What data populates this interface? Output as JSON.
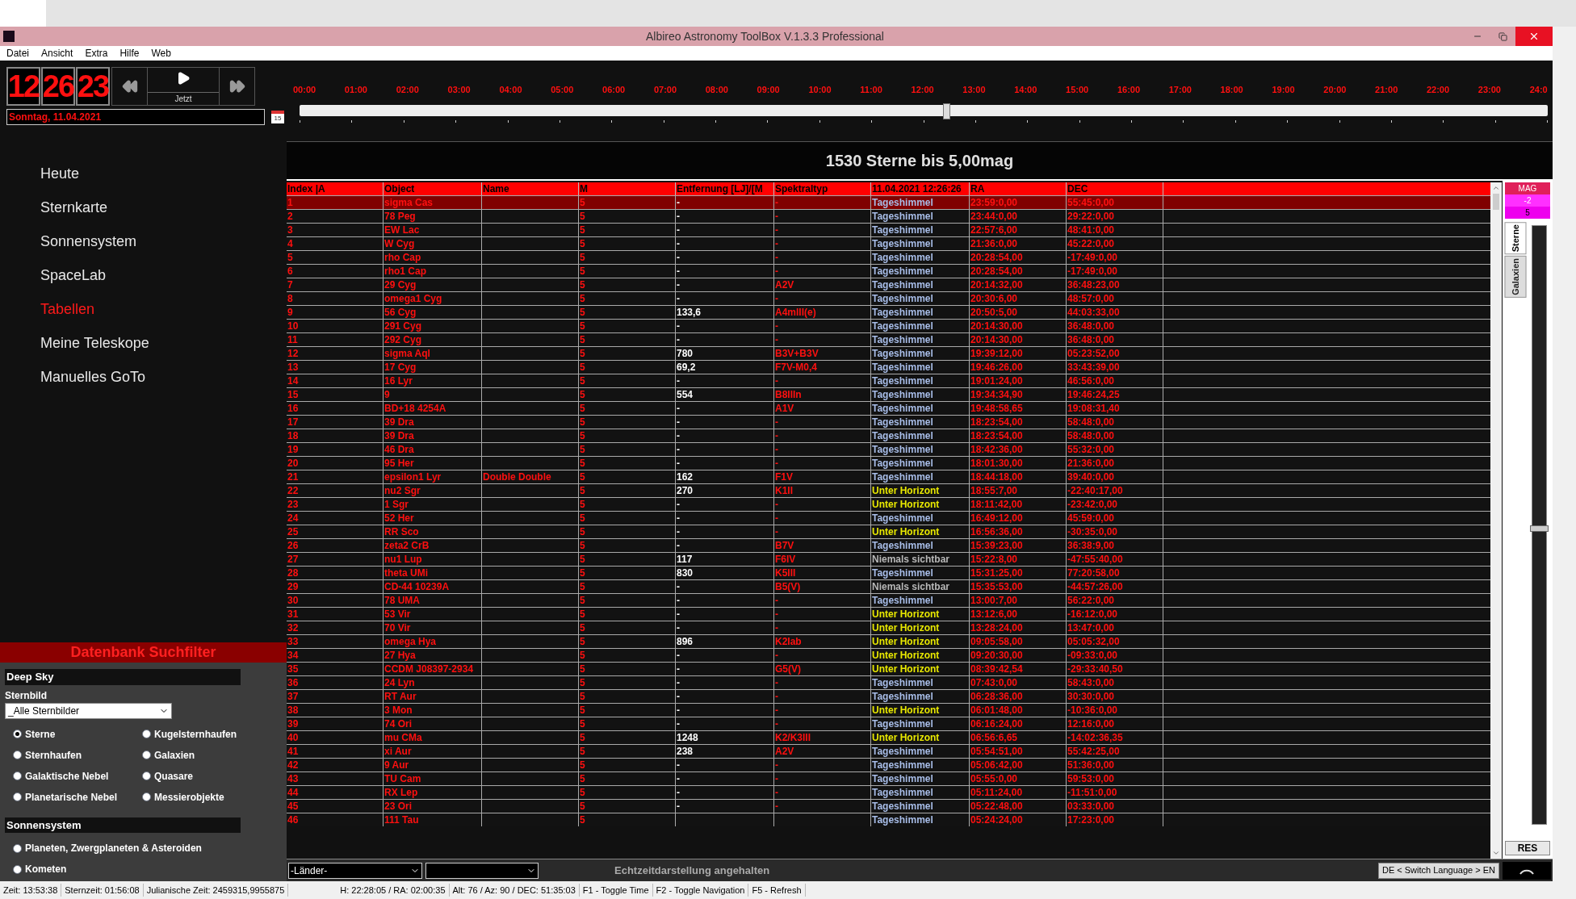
{
  "window": {
    "title": "Albireo Astronomy ToolBox V.1.3.3 Professional"
  },
  "menu": [
    "Datei",
    "Ansicht",
    "Extra",
    "Hilfe",
    "Web"
  ],
  "clock": {
    "hours": "12",
    "minutes": "26",
    "seconds": "23",
    "now_label": "Jetzt",
    "date": "Sonntag, 11.04.2021",
    "calendar_day": "15"
  },
  "timeline": {
    "hours": [
      "00:00",
      "01:00",
      "02:00",
      "03:00",
      "04:00",
      "05:00",
      "06:00",
      "07:00",
      "08:00",
      "09:00",
      "10:00",
      "11:00",
      "12:00",
      "13:00",
      "14:00",
      "15:00",
      "16:00",
      "17:00",
      "18:00",
      "19:00",
      "20:00",
      "21:00",
      "22:00",
      "23:00",
      "24:0"
    ],
    "level": 0.518
  },
  "nav": [
    {
      "label": "Heute",
      "selected": false
    },
    {
      "label": "Sternkarte",
      "selected": false
    },
    {
      "label": "Sonnensystem",
      "selected": false
    },
    {
      "label": "SpaceLab",
      "selected": false
    },
    {
      "label": "Tabellen",
      "selected": true
    },
    {
      "label": "Meine Teleskope",
      "selected": false
    },
    {
      "label": "Manuelles GoTo",
      "selected": false
    }
  ],
  "filter": {
    "title": "Datenbank Suchfilter",
    "deep_sky": {
      "title": "Deep Sky",
      "constellation_label": "Sternbild",
      "constellation_value": "_Alle Sternbilder",
      "options": [
        {
          "label": "Sterne",
          "selected": true
        },
        {
          "label": "Kugelsternhaufen",
          "selected": false
        },
        {
          "label": "Sternhaufen",
          "selected": false
        },
        {
          "label": "Galaxien",
          "selected": false
        },
        {
          "label": "Galaktische Nebel",
          "selected": false
        },
        {
          "label": "Quasare",
          "selected": false
        },
        {
          "label": "Planetarische Nebel",
          "selected": false
        },
        {
          "label": "Messierobjekte",
          "selected": false
        }
      ]
    },
    "solar_system": {
      "title": "Sonnensystem",
      "options": [
        {
          "label": "Planeten, Zwergplaneten & Asteroiden",
          "selected": false
        },
        {
          "label": "Kometen",
          "selected": false
        }
      ]
    }
  },
  "table": {
    "title": "1530 Sterne bis 5,00mag",
    "columns": [
      "Index |A",
      "Object",
      "Name",
      "M",
      "Entfernung [LJ]/[M",
      "Spektraltyp",
      "11.04.2021 12:26:26",
      "RA",
      "DEC"
    ],
    "rows": [
      {
        "cells": [
          "1",
          "sigma Cas",
          null,
          "5",
          "-",
          "-",
          "Tageshimmel",
          "23:59:0,00",
          "55:45:0,00"
        ],
        "kind": "day",
        "selected": true
      },
      {
        "cells": [
          "2",
          "78 Peg",
          null,
          "5",
          "-",
          "-",
          "Tageshimmel",
          "23:44:0,00",
          "29:22:0,00"
        ],
        "kind": "day",
        "selected": false
      },
      {
        "cells": [
          "3",
          "EW Lac",
          null,
          "5",
          "-",
          "-",
          "Tageshimmel",
          "22:57:6,00",
          "48:41:0,00"
        ],
        "kind": "day",
        "selected": false
      },
      {
        "cells": [
          "4",
          "W Cyg",
          null,
          "5",
          "-",
          "-",
          "Tageshimmel",
          "21:36:0,00",
          "45:22:0,00"
        ],
        "kind": "day",
        "selected": false
      },
      {
        "cells": [
          "5",
          "rho Cap",
          null,
          "5",
          "-",
          "-",
          "Tageshimmel",
          "20:28:54,00",
          "-17:49:0,00"
        ],
        "kind": "day",
        "selected": false
      },
      {
        "cells": [
          "6",
          "rho1 Cap",
          null,
          "5",
          "-",
          "-",
          "Tageshimmel",
          "20:28:54,00",
          "-17:49:0,00"
        ],
        "kind": "day",
        "selected": false
      },
      {
        "cells": [
          "7",
          "29 Cyg",
          null,
          "5",
          "-",
          "A2V",
          "Tageshimmel",
          "20:14:32,00",
          "36:48:23,00"
        ],
        "kind": "day",
        "selected": false
      },
      {
        "cells": [
          "8",
          "omega1 Cyg",
          null,
          "5",
          "-",
          "-",
          "Tageshimmel",
          "20:30:6,00",
          "48:57:0,00"
        ],
        "kind": "day",
        "selected": false
      },
      {
        "cells": [
          "9",
          "56 Cyg",
          null,
          "5",
          "133,6",
          "A4mIII(e)",
          "Tageshimmel",
          "20:50:5,00",
          "44:03:33,00"
        ],
        "kind": "day",
        "selected": false
      },
      {
        "cells": [
          "10",
          "291 Cyg",
          null,
          "5",
          "-",
          "-",
          "Tageshimmel",
          "20:14:30,00",
          "36:48:0,00"
        ],
        "kind": "day",
        "selected": false
      },
      {
        "cells": [
          "11",
          "292 Cyg",
          null,
          "5",
          "-",
          "-",
          "Tageshimmel",
          "20:14:30,00",
          "36:48:0,00"
        ],
        "kind": "day",
        "selected": false
      },
      {
        "cells": [
          "12",
          "sigma Aql",
          null,
          "5",
          "780",
          "B3V+B3V",
          "Tageshimmel",
          "19:39:12,00",
          "05:23:52,00"
        ],
        "kind": "day",
        "selected": false
      },
      {
        "cells": [
          "13",
          "17 Cyg",
          null,
          "5",
          "69,2",
          "F7V-M0,4",
          "Tageshimmel",
          "19:46:26,00",
          "33:43:39,00"
        ],
        "kind": "day",
        "selected": false
      },
      {
        "cells": [
          "14",
          "16 Lyr",
          null,
          "5",
          "-",
          "-",
          "Tageshimmel",
          "19:01:24,00",
          "46:56:0,00"
        ],
        "kind": "day",
        "selected": false
      },
      {
        "cells": [
          "15",
          "9",
          null,
          "5",
          "554",
          "B8IIIn",
          "Tageshimmel",
          "19:34:34,90",
          "19:46:24,25"
        ],
        "kind": "day",
        "selected": false
      },
      {
        "cells": [
          "16",
          "BD+18 4254A",
          null,
          "5",
          "-",
          "A1V",
          "Tageshimmel",
          "19:48:58,65",
          "19:08:31,40"
        ],
        "kind": "day",
        "selected": false
      },
      {
        "cells": [
          "17",
          "39 Dra",
          null,
          "5",
          "-",
          "-",
          "Tageshimmel",
          "18:23:54,00",
          "58:48:0,00"
        ],
        "kind": "day",
        "selected": false
      },
      {
        "cells": [
          "18",
          "39 Dra",
          null,
          "5",
          "-",
          "-",
          "Tageshimmel",
          "18:23:54,00",
          "58:48:0,00"
        ],
        "kind": "day",
        "selected": false
      },
      {
        "cells": [
          "19",
          "46 Dra",
          null,
          "5",
          "-",
          "-",
          "Tageshimmel",
          "18:42:36,00",
          "55:32:0,00"
        ],
        "kind": "day",
        "selected": false
      },
      {
        "cells": [
          "20",
          "95 Her",
          null,
          "5",
          "-",
          "-",
          "Tageshimmel",
          "18:01:30,00",
          "21:36:0,00"
        ],
        "kind": "day",
        "selected": false
      },
      {
        "cells": [
          "21",
          "epsilon1 Lyr",
          "Double Double",
          "5",
          "162",
          "F1V",
          "Tageshimmel",
          "18:44:18,00",
          "39:40:0,00"
        ],
        "kind": "day",
        "selected": false
      },
      {
        "cells": [
          "22",
          "nu2 Sgr",
          null,
          "5",
          "270",
          "K1II",
          "Unter Horizont",
          "18:55:7,00",
          "-22:40:17,00"
        ],
        "kind": "below",
        "selected": false
      },
      {
        "cells": [
          "23",
          "1 Sgr",
          null,
          "5",
          "-",
          "-",
          "Unter Horizont",
          "18:11:42,00",
          "-23:42:0,00"
        ],
        "kind": "below",
        "selected": false
      },
      {
        "cells": [
          "24",
          "52 Her",
          null,
          "5",
          "-",
          "-",
          "Tageshimmel",
          "16:49:12,00",
          "45:59:0,00"
        ],
        "kind": "day",
        "selected": false
      },
      {
        "cells": [
          "25",
          "RR Sco",
          null,
          "5",
          "-",
          "-",
          "Unter Horizont",
          "16:56:36,00",
          "-30:35:0,00"
        ],
        "kind": "below",
        "selected": false
      },
      {
        "cells": [
          "26",
          "zeta2 CrB",
          null,
          "5",
          "-",
          "B7V",
          "Tageshimmel",
          "15:39:23,00",
          "36:38:9,00"
        ],
        "kind": "day",
        "selected": false
      },
      {
        "cells": [
          "27",
          "nu1 Lup",
          null,
          "5",
          "117",
          "F6IV",
          "Niemals sichtbar",
          "15:22:8,00",
          "-47:55:40,00"
        ],
        "kind": "never",
        "selected": false
      },
      {
        "cells": [
          "28",
          "theta UMi",
          null,
          "5",
          "830",
          "K5III",
          "Tageshimmel",
          "15:31:25,00",
          "77:20:58,00"
        ],
        "kind": "day",
        "selected": false
      },
      {
        "cells": [
          "29",
          "CD-44 10239A",
          null,
          "5",
          "-",
          "B5(V)",
          "Niemals sichtbar",
          "15:35:53,00",
          "-44:57:26,00"
        ],
        "kind": "never",
        "selected": false
      },
      {
        "cells": [
          "30",
          "78 UMA",
          null,
          "5",
          "-",
          "-",
          "Tageshimmel",
          "13:00:7,00",
          "56:22:0,00"
        ],
        "kind": "day",
        "selected": false
      },
      {
        "cells": [
          "31",
          "53 Vir",
          null,
          "5",
          "-",
          "-",
          "Unter Horizont",
          "13:12:6,00",
          "-16:12:0,00"
        ],
        "kind": "below",
        "selected": false
      },
      {
        "cells": [
          "32",
          "70 Vir",
          null,
          "5",
          "-",
          "-",
          "Unter Horizont",
          "13:28:24,00",
          "13:47:0,00"
        ],
        "kind": "below",
        "selected": false
      },
      {
        "cells": [
          "33",
          "omega Hya",
          null,
          "5",
          "896",
          "K2Iab",
          "Unter Horizont",
          "09:05:58,00",
          "05:05:32,00"
        ],
        "kind": "below",
        "selected": false
      },
      {
        "cells": [
          "34",
          "27 Hya",
          null,
          "5",
          "-",
          "-",
          "Unter Horizont",
          "09:20:30,00",
          "-09:33:0,00"
        ],
        "kind": "below",
        "selected": false
      },
      {
        "cells": [
          "35",
          "CCDM J08397-2934",
          null,
          "5",
          "-",
          "G5(V)",
          "Unter Horizont",
          "08:39:42,54",
          "-29:33:40,50"
        ],
        "kind": "below",
        "selected": false
      },
      {
        "cells": [
          "36",
          "24 Lyn",
          null,
          "5",
          "-",
          "-",
          "Tageshimmel",
          "07:43:0,00",
          "58:43:0,00"
        ],
        "kind": "day",
        "selected": false
      },
      {
        "cells": [
          "37",
          "RT Aur",
          null,
          "5",
          "-",
          "-",
          "Tageshimmel",
          "06:28:36,00",
          "30:30:0,00"
        ],
        "kind": "day",
        "selected": false
      },
      {
        "cells": [
          "38",
          "3 Mon",
          null,
          "5",
          "-",
          "-",
          "Unter Horizont",
          "06:01:48,00",
          "-10:36:0,00"
        ],
        "kind": "below",
        "selected": false
      },
      {
        "cells": [
          "39",
          "74 Ori",
          null,
          "5",
          "-",
          "-",
          "Tageshimmel",
          "06:16:24,00",
          "12:16:0,00"
        ],
        "kind": "day",
        "selected": false
      },
      {
        "cells": [
          "40",
          "mu CMa",
          null,
          "5",
          "1248",
          "K2/K3III",
          "Unter Horizont",
          "06:56:6,65",
          "-14:02:36,35"
        ],
        "kind": "below",
        "selected": false
      },
      {
        "cells": [
          "41",
          "xi Aur",
          null,
          "5",
          "238",
          "A2V",
          "Tageshimmel",
          "05:54:51,00",
          "55:42:25,00"
        ],
        "kind": "day",
        "selected": false
      },
      {
        "cells": [
          "42",
          "9 Aur",
          null,
          "5",
          "-",
          "-",
          "Tageshimmel",
          "05:06:42,00",
          "51:36:0,00"
        ],
        "kind": "day",
        "selected": false
      },
      {
        "cells": [
          "43",
          "TU Cam",
          null,
          "5",
          "-",
          "-",
          "Tageshimmel",
          "05:55:0,00",
          "59:53:0,00"
        ],
        "kind": "day",
        "selected": false
      },
      {
        "cells": [
          "44",
          "RX Lep",
          null,
          "5",
          "-",
          "-",
          "Tageshimmel",
          "05:11:24,00",
          "-11:51:0,00"
        ],
        "kind": "day",
        "selected": false
      },
      {
        "cells": [
          "45",
          "23 Ori",
          null,
          "5",
          "-",
          "-",
          "Tageshimmel",
          "05:22:48,00",
          "03:33:0,00"
        ],
        "kind": "day",
        "selected": false
      },
      {
        "cells": [
          "46",
          "111 Tau",
          null,
          "5",
          null,
          null,
          "Tageshimmel",
          "05:24:24,00",
          "17:23:0,00"
        ],
        "kind": "day",
        "selected": false
      }
    ]
  },
  "mag_panel": {
    "header": "MAG",
    "min": "-2",
    "max": "5",
    "tabs": [
      {
        "label": "Sterne",
        "selected": true
      },
      {
        "label": "Galaxien",
        "selected": false
      }
    ],
    "level": 0.5,
    "reset": "RES"
  },
  "bottom": {
    "country": "-Länder-",
    "status": "Echtzeitdarstellung angehalten",
    "language": "DE < Switch Language > EN"
  },
  "status_bar": [
    "Zeit: 13:53:38",
    "Sternzeit: 01:56:08",
    "Julianische Zeit: 2459315,9955875",
    "H: 22:28:05 / RA: 02:00:35",
    "Alt: 76 / Az: 90 / DEC: 51:35:03",
    "F1 - Toggle Time",
    "F2 - Toggle Navigation",
    "F5 - Refresh"
  ]
}
